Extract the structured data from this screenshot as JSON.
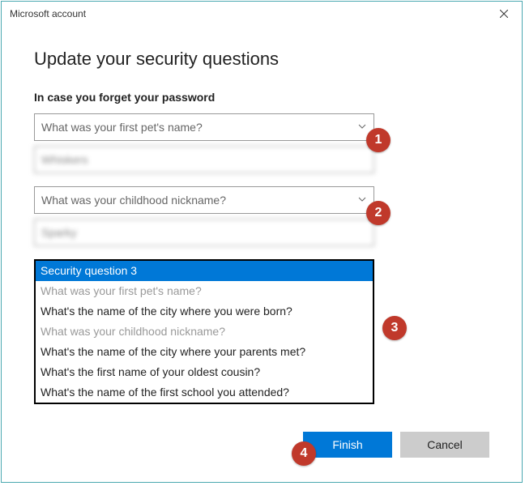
{
  "window": {
    "title": "Microsoft account"
  },
  "heading": "Update your security questions",
  "subheading": "In case you forget your password",
  "q1": {
    "question": "What was your first pet's name?",
    "answer": "Whiskers"
  },
  "q2": {
    "question": "What was your childhood nickname?",
    "answer": "Sparky"
  },
  "dropdown": {
    "options": [
      {
        "label": "Security question 3",
        "selected": true,
        "disabled": false
      },
      {
        "label": "What was your first pet's name?",
        "selected": false,
        "disabled": true
      },
      {
        "label": "What's the name of the city where you were born?",
        "selected": false,
        "disabled": false
      },
      {
        "label": "What was your childhood nickname?",
        "selected": false,
        "disabled": true
      },
      {
        "label": "What's the name of the city where your parents met?",
        "selected": false,
        "disabled": false
      },
      {
        "label": "What's the first name of your oldest cousin?",
        "selected": false,
        "disabled": false
      },
      {
        "label": "What's the name of the first school you attended?",
        "selected": false,
        "disabled": false
      }
    ]
  },
  "buttons": {
    "finish": "Finish",
    "cancel": "Cancel"
  },
  "badges": {
    "b1": "1",
    "b2": "2",
    "b3": "3",
    "b4": "4"
  }
}
